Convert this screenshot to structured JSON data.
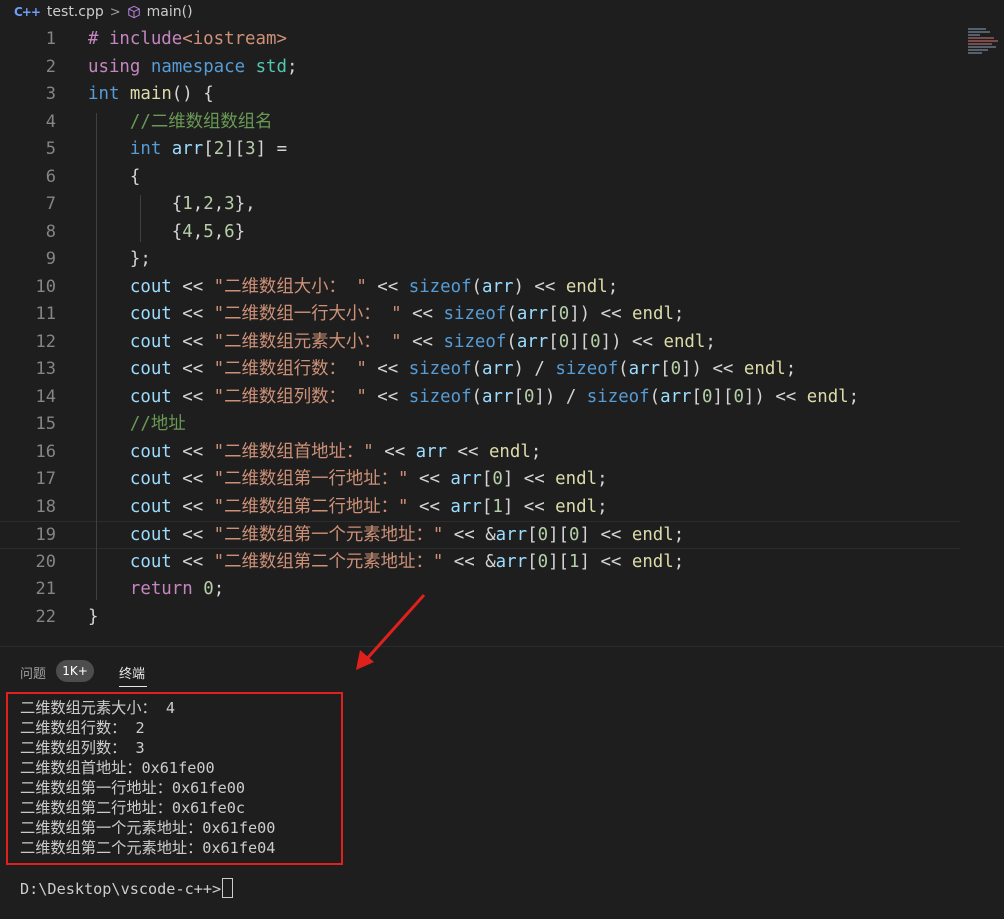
{
  "breadcrumb": {
    "file_icon": "C++",
    "file": "test.cpp",
    "separator": ">",
    "symbol": "main()"
  },
  "editor": {
    "lines": [
      {
        "n": "1",
        "tokens": [
          [
            "ctl",
            "# include"
          ],
          [
            "str",
            "<iostream>"
          ]
        ]
      },
      {
        "n": "2",
        "tokens": [
          [
            "ctl",
            "using"
          ],
          [
            "op",
            " "
          ],
          [
            "kw",
            "namespace"
          ],
          [
            "op",
            " "
          ],
          [
            "ns",
            "std"
          ],
          [
            "op",
            ";"
          ]
        ]
      },
      {
        "n": "3",
        "tokens": [
          [
            "kw",
            "int"
          ],
          [
            "op",
            " "
          ],
          [
            "fn",
            "main"
          ],
          [
            "op",
            "() {"
          ]
        ]
      },
      {
        "n": "4",
        "tokens": [
          [
            "op",
            "    "
          ],
          [
            "cmt",
            "//二维数组数组名"
          ]
        ]
      },
      {
        "n": "5",
        "tokens": [
          [
            "op",
            "    "
          ],
          [
            "kw",
            "int"
          ],
          [
            "op",
            " "
          ],
          [
            "var",
            "arr"
          ],
          [
            "op",
            "["
          ],
          [
            "num",
            "2"
          ],
          [
            "op",
            "]["
          ],
          [
            "num",
            "3"
          ],
          [
            "op",
            "] ="
          ]
        ]
      },
      {
        "n": "6",
        "tokens": [
          [
            "op",
            "    {"
          ]
        ]
      },
      {
        "n": "7",
        "tokens": [
          [
            "op",
            "        {"
          ],
          [
            "num",
            "1"
          ],
          [
            "op",
            ","
          ],
          [
            "num",
            "2"
          ],
          [
            "op",
            ","
          ],
          [
            "num",
            "3"
          ],
          [
            "op",
            "},"
          ]
        ]
      },
      {
        "n": "8",
        "tokens": [
          [
            "op",
            "        {"
          ],
          [
            "num",
            "4"
          ],
          [
            "op",
            ","
          ],
          [
            "num",
            "5"
          ],
          [
            "op",
            ","
          ],
          [
            "num",
            "6"
          ],
          [
            "op",
            "}"
          ]
        ]
      },
      {
        "n": "9",
        "tokens": [
          [
            "op",
            "    };"
          ]
        ]
      },
      {
        "n": "10",
        "tokens": [
          [
            "op",
            "    "
          ],
          [
            "var",
            "cout"
          ],
          [
            "op",
            " << "
          ],
          [
            "str",
            "\"二维数组大小： \""
          ],
          [
            "op",
            " << "
          ],
          [
            "kw",
            "sizeof"
          ],
          [
            "op",
            "("
          ],
          [
            "var",
            "arr"
          ],
          [
            "op",
            ") << "
          ],
          [
            "fn",
            "endl"
          ],
          [
            "op",
            ";"
          ]
        ]
      },
      {
        "n": "11",
        "tokens": [
          [
            "op",
            "    "
          ],
          [
            "var",
            "cout"
          ],
          [
            "op",
            " << "
          ],
          [
            "str",
            "\"二维数组一行大小： \""
          ],
          [
            "op",
            " << "
          ],
          [
            "kw",
            "sizeof"
          ],
          [
            "op",
            "("
          ],
          [
            "var",
            "arr"
          ],
          [
            "op",
            "["
          ],
          [
            "num",
            "0"
          ],
          [
            "op",
            "]) << "
          ],
          [
            "fn",
            "endl"
          ],
          [
            "op",
            ";"
          ]
        ]
      },
      {
        "n": "12",
        "tokens": [
          [
            "op",
            "    "
          ],
          [
            "var",
            "cout"
          ],
          [
            "op",
            " << "
          ],
          [
            "str",
            "\"二维数组元素大小： \""
          ],
          [
            "op",
            " << "
          ],
          [
            "kw",
            "sizeof"
          ],
          [
            "op",
            "("
          ],
          [
            "var",
            "arr"
          ],
          [
            "op",
            "["
          ],
          [
            "num",
            "0"
          ],
          [
            "op",
            "]["
          ],
          [
            "num",
            "0"
          ],
          [
            "op",
            "]) << "
          ],
          [
            "fn",
            "endl"
          ],
          [
            "op",
            ";"
          ]
        ]
      },
      {
        "n": "13",
        "tokens": [
          [
            "op",
            "    "
          ],
          [
            "var",
            "cout"
          ],
          [
            "op",
            " << "
          ],
          [
            "str",
            "\"二维数组行数： \""
          ],
          [
            "op",
            " << "
          ],
          [
            "kw",
            "sizeof"
          ],
          [
            "op",
            "("
          ],
          [
            "var",
            "arr"
          ],
          [
            "op",
            ") / "
          ],
          [
            "kw",
            "sizeof"
          ],
          [
            "op",
            "("
          ],
          [
            "var",
            "arr"
          ],
          [
            "op",
            "["
          ],
          [
            "num",
            "0"
          ],
          [
            "op",
            "]) << "
          ],
          [
            "fn",
            "endl"
          ],
          [
            "op",
            ";"
          ]
        ]
      },
      {
        "n": "14",
        "tokens": [
          [
            "op",
            "    "
          ],
          [
            "var",
            "cout"
          ],
          [
            "op",
            " << "
          ],
          [
            "str",
            "\"二维数组列数： \""
          ],
          [
            "op",
            " << "
          ],
          [
            "kw",
            "sizeof"
          ],
          [
            "op",
            "("
          ],
          [
            "var",
            "arr"
          ],
          [
            "op",
            "["
          ],
          [
            "num",
            "0"
          ],
          [
            "op",
            "]) / "
          ],
          [
            "kw",
            "sizeof"
          ],
          [
            "op",
            "("
          ],
          [
            "var",
            "arr"
          ],
          [
            "op",
            "["
          ],
          [
            "num",
            "0"
          ],
          [
            "op",
            "]["
          ],
          [
            "num",
            "0"
          ],
          [
            "op",
            "]) << "
          ],
          [
            "fn",
            "endl"
          ],
          [
            "op",
            ";"
          ]
        ]
      },
      {
        "n": "15",
        "tokens": [
          [
            "op",
            "    "
          ],
          [
            "cmt",
            "//地址"
          ]
        ]
      },
      {
        "n": "16",
        "tokens": [
          [
            "op",
            "    "
          ],
          [
            "var",
            "cout"
          ],
          [
            "op",
            " << "
          ],
          [
            "str",
            "\"二维数组首地址：\""
          ],
          [
            "op",
            " << "
          ],
          [
            "var",
            "arr"
          ],
          [
            "op",
            " << "
          ],
          [
            "fn",
            "endl"
          ],
          [
            "op",
            ";"
          ]
        ]
      },
      {
        "n": "17",
        "tokens": [
          [
            "op",
            "    "
          ],
          [
            "var",
            "cout"
          ],
          [
            "op",
            " << "
          ],
          [
            "str",
            "\"二维数组第一行地址：\""
          ],
          [
            "op",
            " << "
          ],
          [
            "var",
            "arr"
          ],
          [
            "op",
            "["
          ],
          [
            "num",
            "0"
          ],
          [
            "op",
            "] << "
          ],
          [
            "fn",
            "endl"
          ],
          [
            "op",
            ";"
          ]
        ]
      },
      {
        "n": "18",
        "tokens": [
          [
            "op",
            "    "
          ],
          [
            "var",
            "cout"
          ],
          [
            "op",
            " << "
          ],
          [
            "str",
            "\"二维数组第二行地址：\""
          ],
          [
            "op",
            " << "
          ],
          [
            "var",
            "arr"
          ],
          [
            "op",
            "["
          ],
          [
            "num",
            "1"
          ],
          [
            "op",
            "] << "
          ],
          [
            "fn",
            "endl"
          ],
          [
            "op",
            ";"
          ]
        ]
      },
      {
        "n": "19",
        "tokens": [
          [
            "op",
            "    "
          ],
          [
            "var",
            "cout"
          ],
          [
            "op",
            " << "
          ],
          [
            "str",
            "\"二维数组第一个元素地址：\""
          ],
          [
            "op",
            " << &"
          ],
          [
            "var",
            "arr"
          ],
          [
            "op",
            "["
          ],
          [
            "num",
            "0"
          ],
          [
            "op",
            "]["
          ],
          [
            "num",
            "0"
          ],
          [
            "op",
            "] << "
          ],
          [
            "fn",
            "endl"
          ],
          [
            "op",
            ";"
          ]
        ]
      },
      {
        "n": "20",
        "tokens": [
          [
            "op",
            "    "
          ],
          [
            "var",
            "cout"
          ],
          [
            "op",
            " << "
          ],
          [
            "str",
            "\"二维数组第二个元素地址：\""
          ],
          [
            "op",
            " << &"
          ],
          [
            "var",
            "arr"
          ],
          [
            "op",
            "["
          ],
          [
            "num",
            "0"
          ],
          [
            "op",
            "]["
          ],
          [
            "num",
            "1"
          ],
          [
            "op",
            "] << "
          ],
          [
            "fn",
            "endl"
          ],
          [
            "op",
            ";"
          ]
        ]
      },
      {
        "n": "21",
        "tokens": [
          [
            "op",
            "    "
          ],
          [
            "ctl",
            "return"
          ],
          [
            "op",
            " "
          ],
          [
            "num",
            "0"
          ],
          [
            "op",
            ";"
          ]
        ]
      },
      {
        "n": "22",
        "tokens": [
          [
            "op",
            "}"
          ]
        ]
      }
    ]
  },
  "panel": {
    "tab_problems": "问题",
    "problems_badge": "1K+",
    "tab_terminal": "终端",
    "output": [
      "二维数组元素大小： 4",
      "二维数组行数： 2",
      "二维数组列数： 3",
      "二维数组首地址：0x61fe00",
      "二维数组第一行地址：0x61fe00",
      "二维数组第二行地址：0x61fe0c",
      "二维数组第一个元素地址：0x61fe00",
      "二维数组第二个元素地址：0x61fe04"
    ],
    "prompt": "D:\\Desktop\\vscode-c++>"
  },
  "colors": {
    "background": "#1e1e1e",
    "annotation_red": "#e0201c",
    "keyword": "#569cd6",
    "string": "#ce9178",
    "comment": "#6a9955",
    "number": "#b5cea8"
  },
  "icons": [
    "cpp-file-icon",
    "chevron-right-icon",
    "method-cube-icon",
    "red-arrow-icon"
  ]
}
